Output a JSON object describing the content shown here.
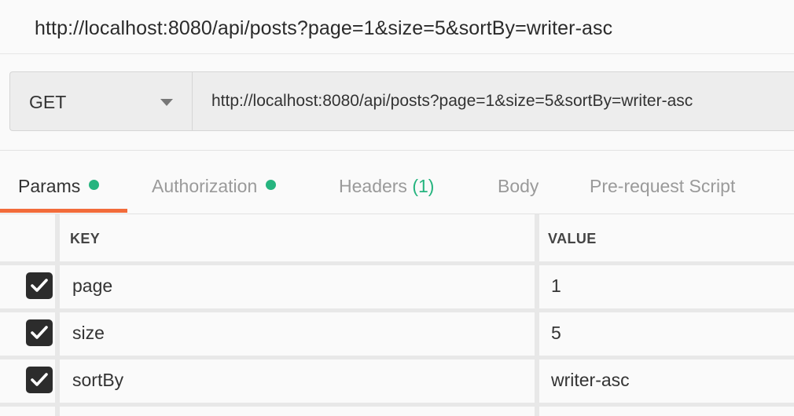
{
  "window": {
    "title": "http://localhost:8080/api/posts?page=1&size=5&sortBy=writer-asc"
  },
  "request": {
    "method": "GET",
    "url": "http://localhost:8080/api/posts?page=1&size=5&sortBy=writer-asc"
  },
  "tabs": [
    {
      "label": "Params",
      "active": true,
      "indicator": true
    },
    {
      "label": "Authorization",
      "active": false,
      "indicator": true
    },
    {
      "label": "Headers",
      "count": "(1)",
      "active": false
    },
    {
      "label": "Body",
      "active": false
    },
    {
      "label": "Pre-request Script",
      "active": false
    }
  ],
  "params": {
    "columns": [
      "KEY",
      "VALUE"
    ],
    "rows": [
      {
        "key": "page",
        "value": "1",
        "checked": true
      },
      {
        "key": "size",
        "value": "5",
        "checked": true
      },
      {
        "key": "sortBy",
        "value": "writer-asc",
        "checked": true
      }
    ]
  },
  "colors": {
    "accent": "#f26b3a",
    "indicator": "#26b47f"
  }
}
